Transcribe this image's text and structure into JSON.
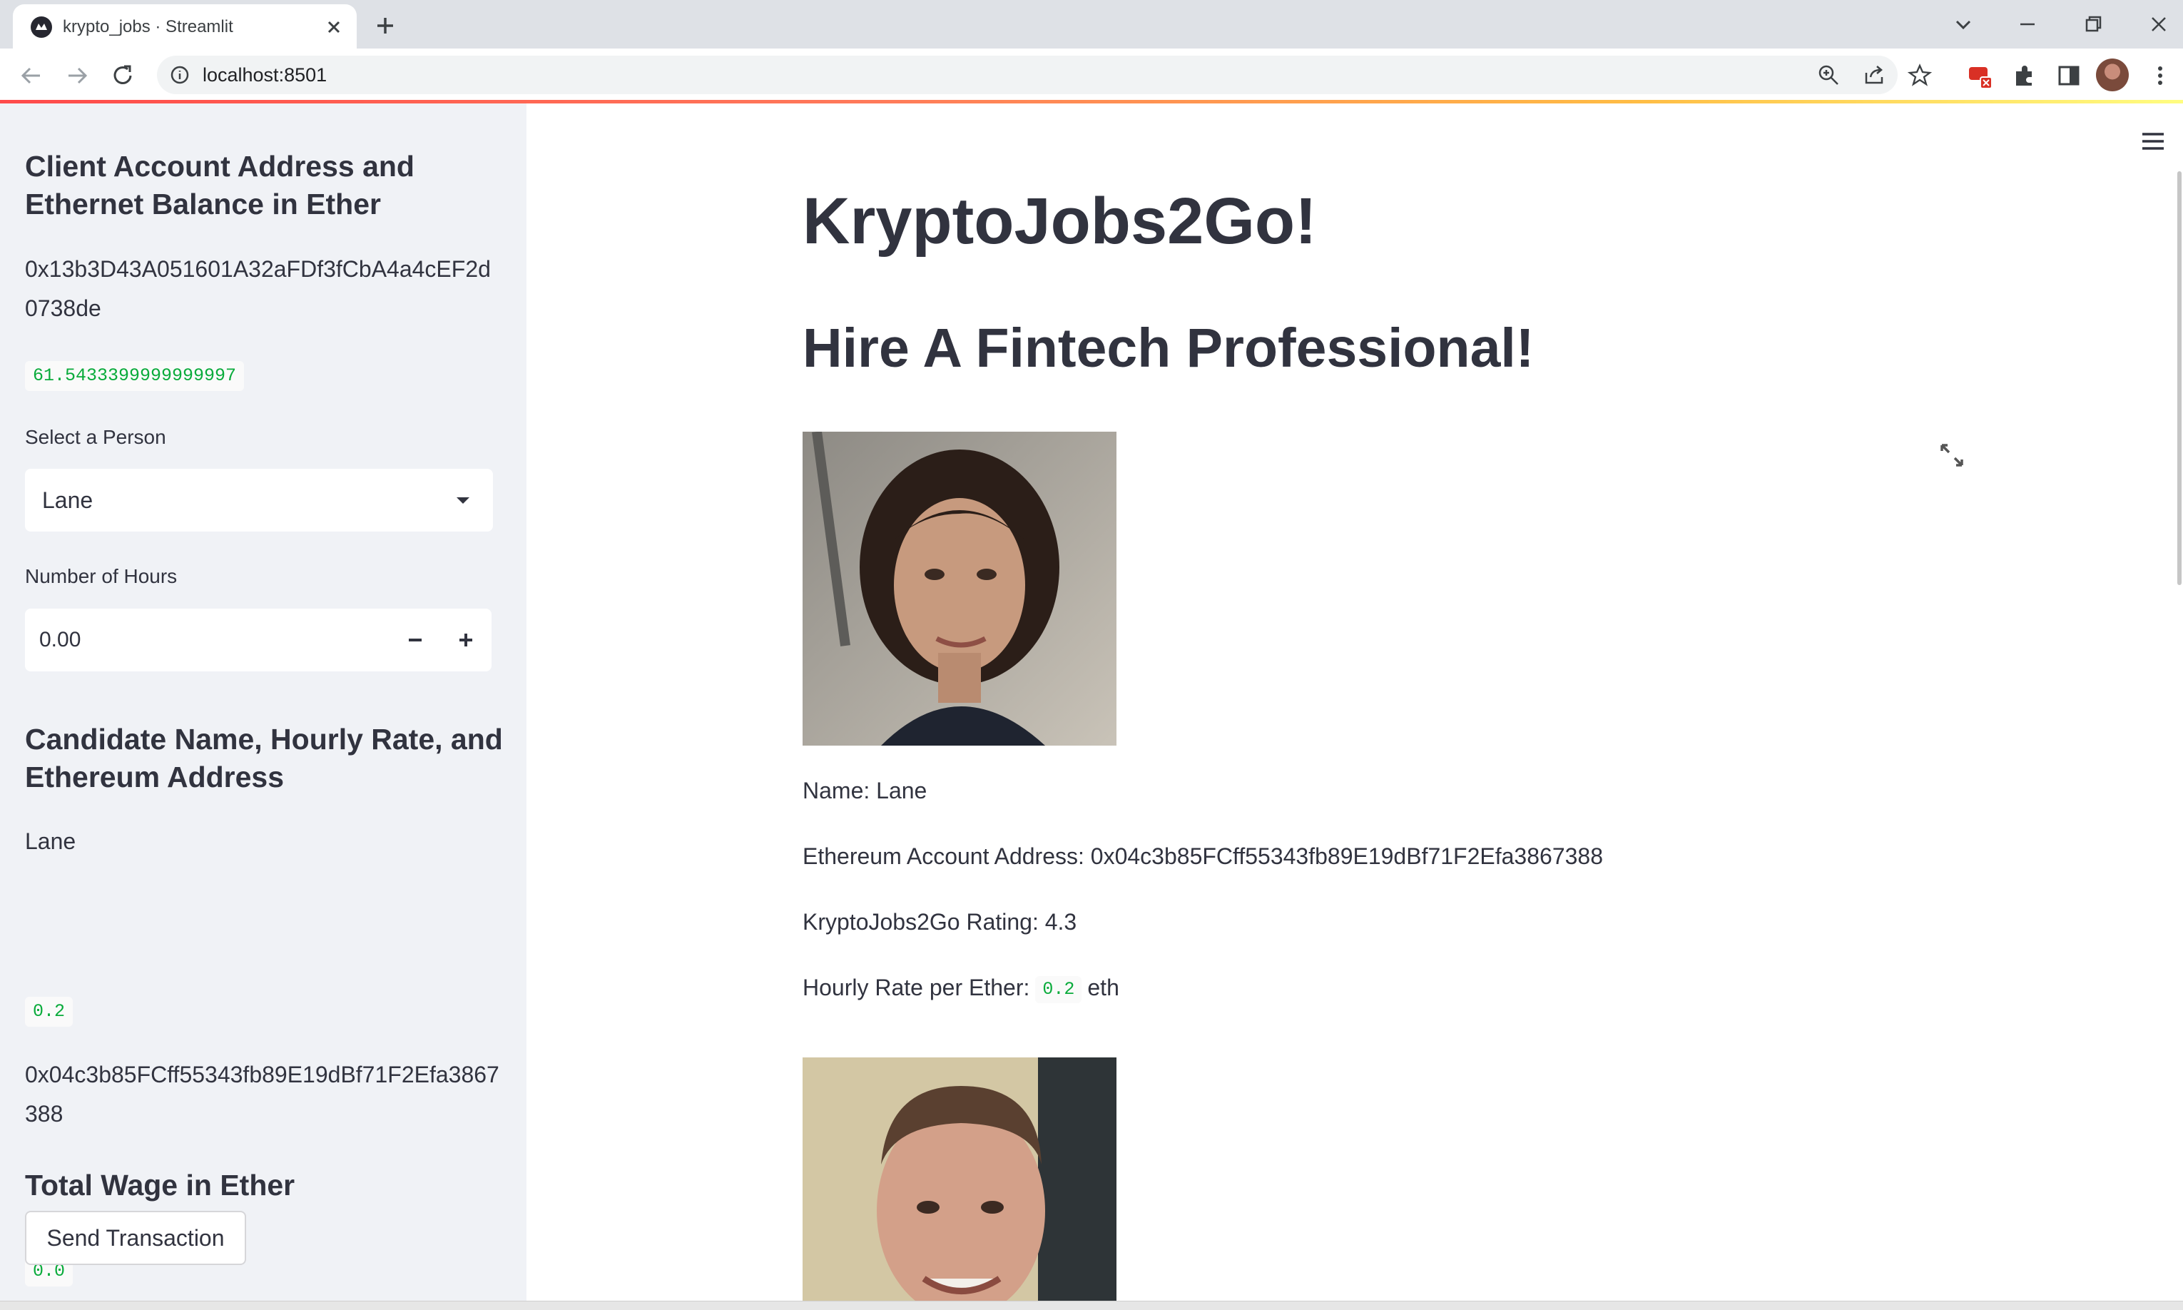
{
  "browser": {
    "tab_title": "krypto_jobs · Streamlit",
    "url": "localhost:8501"
  },
  "sidebar": {
    "client_heading": "Client Account Address and Ethernet Balance in Ether",
    "client_address": "0x13b3D43A051601A32aFDf3fCbA4a4cEF2d0738de",
    "client_balance": "61.5433399999999997",
    "select_label": "Select a Person",
    "select_value": "Lane",
    "hours_label": "Number of Hours",
    "hours_value": "0.00",
    "candidate_heading": "Candidate Name, Hourly Rate, and Ethereum Address",
    "candidate_name": "Lane",
    "candidate_rate": "0.2",
    "candidate_address": "0x04c3b85FCff55343fb89E19dBf71F2Efa3867388",
    "wage_heading": "Total Wage in Ether",
    "wage_value": "0.0",
    "send_button": "Send Transaction"
  },
  "main": {
    "title": "KryptoJobs2Go!",
    "subtitle": "Hire A Fintech Professional!",
    "name_line": "Name: Lane",
    "address_line": "Ethereum Account Address: 0x04c3b85FCff55343fb89E19dBf71F2Efa3867388",
    "rating_line": "KryptoJobs2Go Rating: 4.3",
    "rate_prefix": "Hourly Rate per Ether:",
    "rate_value": "0.2",
    "rate_suffix": "eth"
  },
  "colors": {
    "sidebar_bg": "#f0f2f6",
    "code_green": "#09ab3b",
    "text": "#31333f",
    "accent_red": "#ff4b4b"
  },
  "icons": [
    "streamlit-favicon-icon",
    "close-icon",
    "plus-icon",
    "chevron-down-icon",
    "minimize-icon",
    "restore-icon",
    "back-icon",
    "forward-icon",
    "reload-icon",
    "info-icon",
    "zoom-icon",
    "share-icon",
    "star-icon",
    "extension-icon",
    "puzzle-icon",
    "sidepanel-icon",
    "kebab-icon",
    "hamburger-icon",
    "expand-icon",
    "caret-down-icon",
    "minus-icon"
  ]
}
